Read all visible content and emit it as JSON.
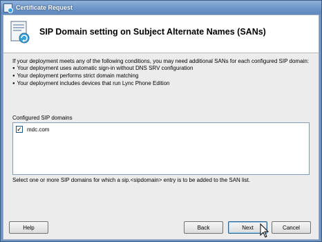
{
  "window": {
    "title": "Certificate Request"
  },
  "header": {
    "title": "SIP Domain setting on Subject Alternate Names (SANs)",
    "icon": "certificate-wizard-icon"
  },
  "intro": {
    "text": "If your deployment meets any of the following conditions, you may need additional SANs for each configured SIP domain:",
    "bullets": [
      "Your deployment uses automatic sign-in without DNS SRV configuration",
      "Your deployment performs strict domain matching",
      "Your deployment includes devices that run Lync Phone Edition"
    ]
  },
  "sip_domains": {
    "label": "Configured SIP domains",
    "items": [
      {
        "label": "mdc.com",
        "checked": true
      }
    ]
  },
  "hint": "Select one or more SIP domains for which a sip.<sipdomain> entry is to be added to the SAN list.",
  "buttons": {
    "help": "Help",
    "back": "Back",
    "next": "Next",
    "cancel": "Cancel"
  },
  "colors": {
    "titlebar": "#6b93c7",
    "dialog_bg": "#ececec",
    "accent": "#3aa1d8"
  }
}
